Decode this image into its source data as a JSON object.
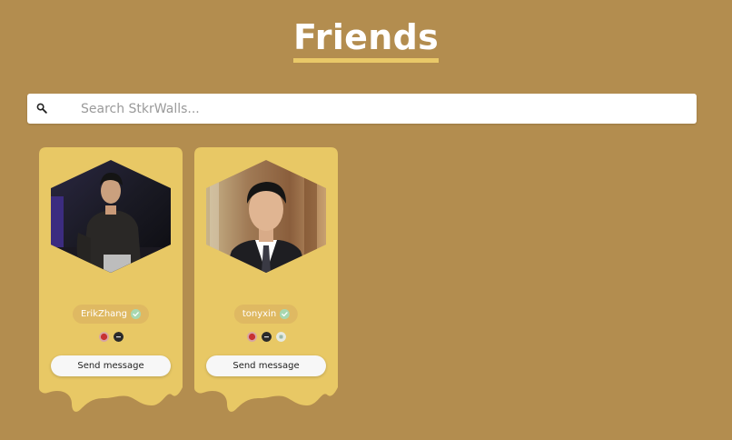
{
  "page": {
    "title": "Friends",
    "background_color": "#b38d4f",
    "accent_color": "#e9c868"
  },
  "search": {
    "placeholder": "Search StkrWalls...",
    "value": ""
  },
  "friends": [
    {
      "username": "ErikZhang",
      "verified": true,
      "badges": [
        "red-badge",
        "dark-badge"
      ],
      "button_label": "Send message"
    },
    {
      "username": "tonyxin",
      "verified": true,
      "badges": [
        "red-badge",
        "dark-badge",
        "light-badge"
      ],
      "button_label": "Send message"
    }
  ]
}
